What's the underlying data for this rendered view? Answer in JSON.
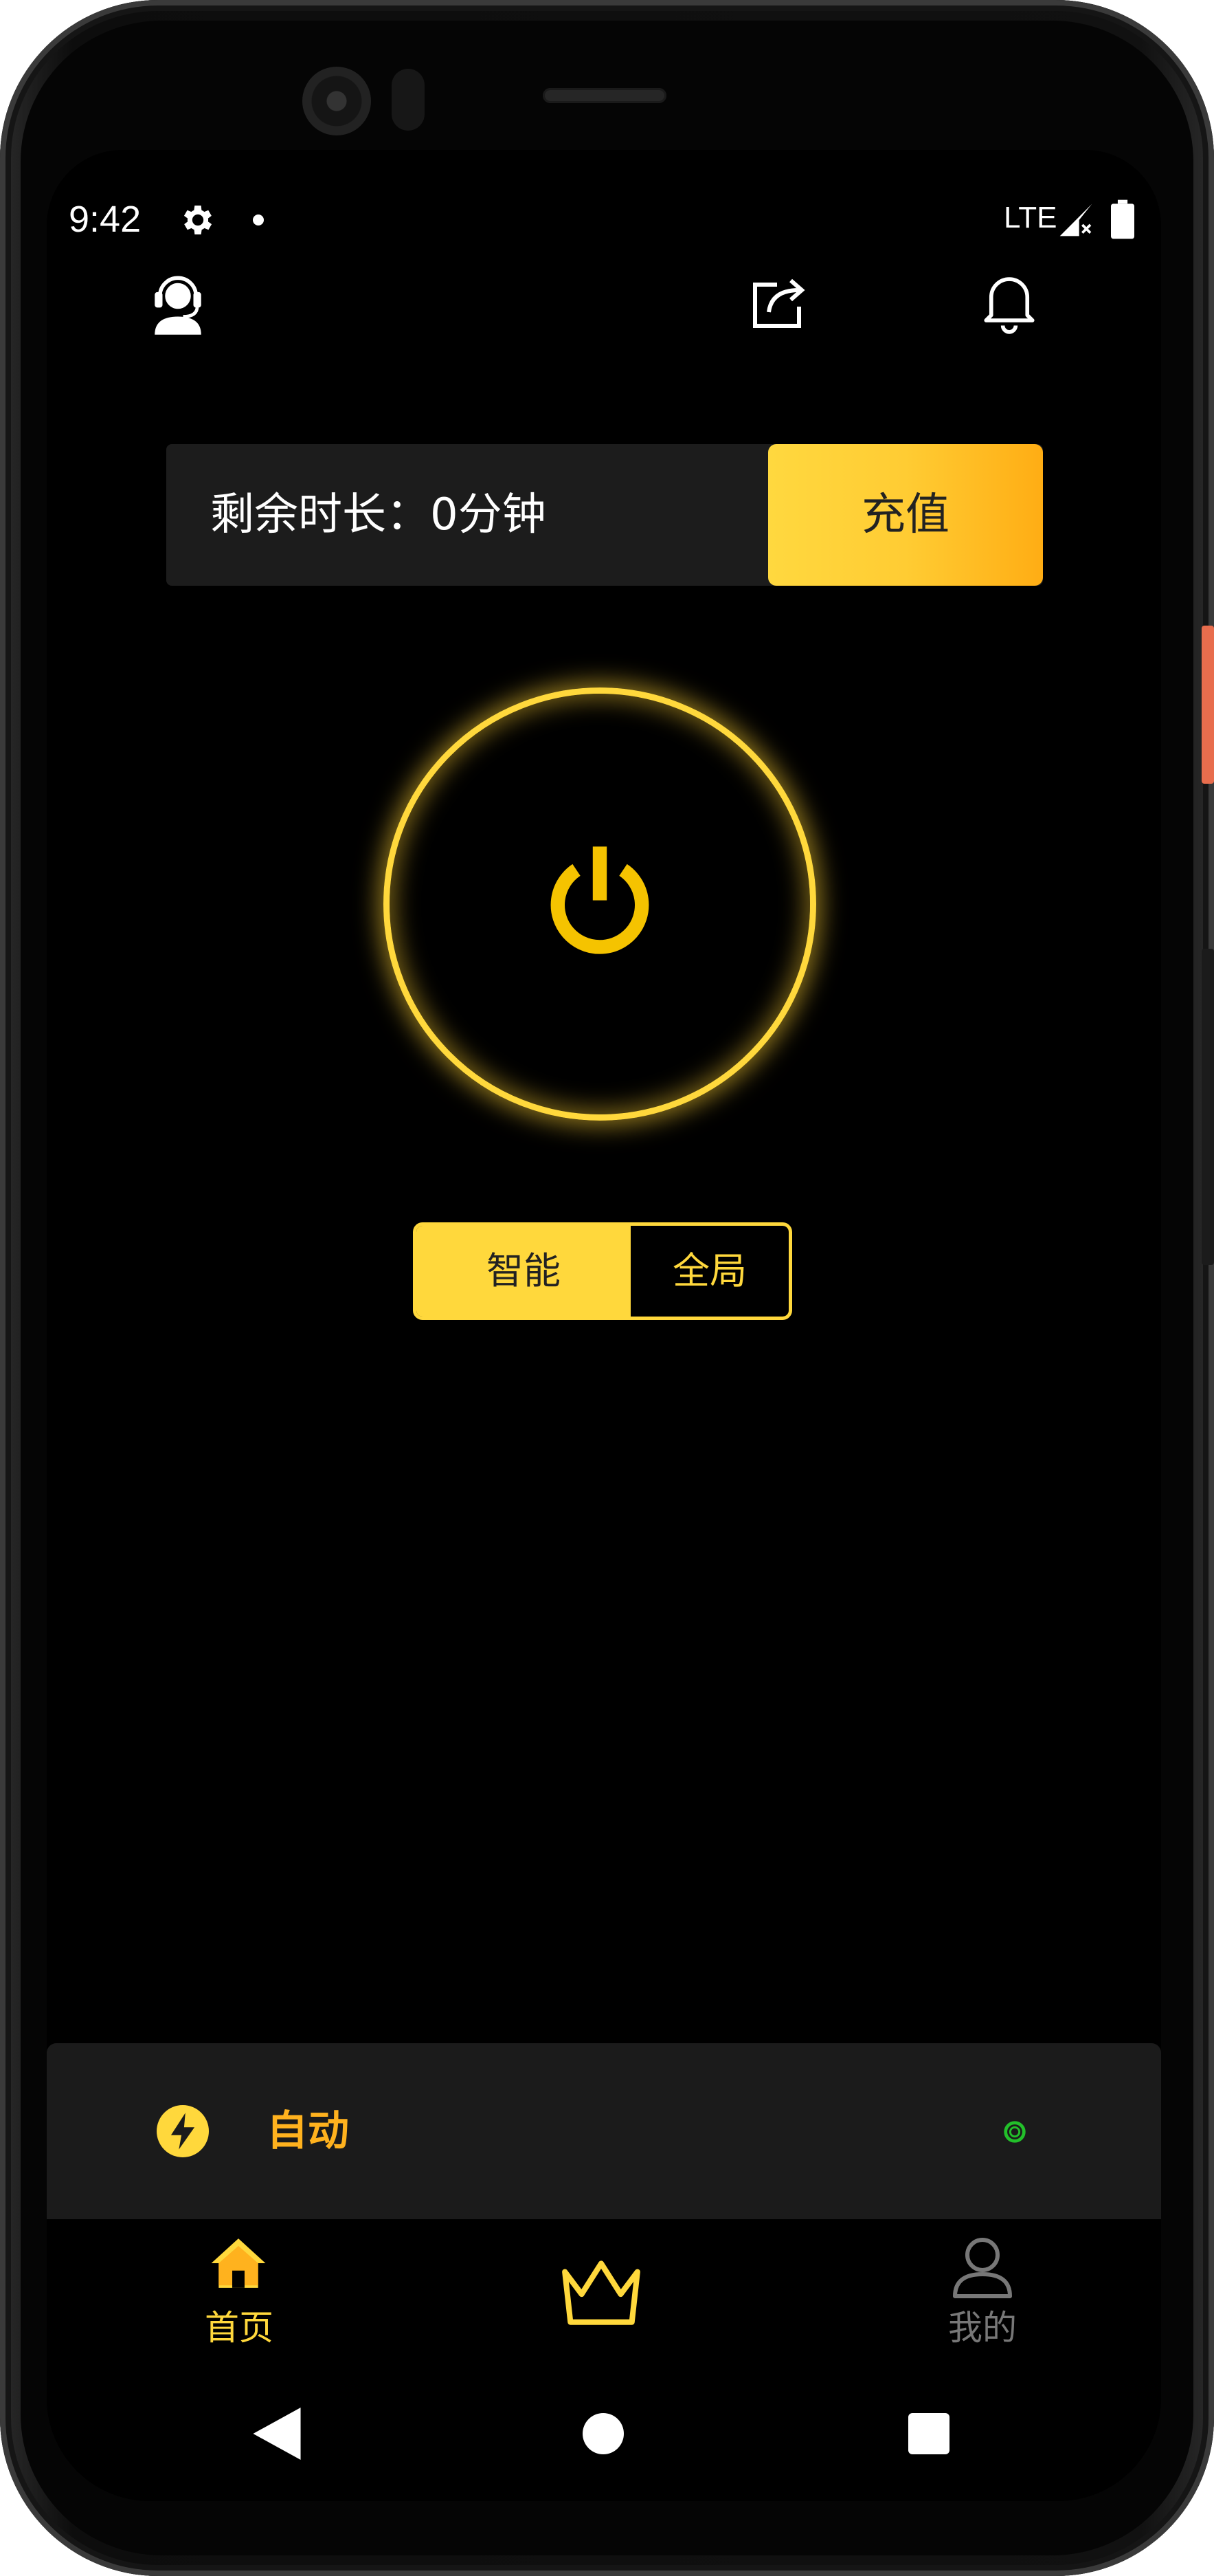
{
  "status_bar": {
    "time": "9:42",
    "network": "LTE",
    "icons": [
      "gear-icon",
      "notification-dot",
      "signal-icon",
      "battery-icon"
    ]
  },
  "header": {
    "icons": [
      "customer-service-icon",
      "share-icon",
      "bell-icon"
    ]
  },
  "time_bar": {
    "label": "剩余时长：0分钟",
    "recharge_label": "充值"
  },
  "power": {
    "icon": "power-icon"
  },
  "mode": {
    "options": [
      "智能",
      "全局"
    ],
    "selected": "智能"
  },
  "auto_bar": {
    "label": "自动",
    "icon": "lightning-icon",
    "status_icon": "status-ring-icon"
  },
  "bottom_nav": {
    "items": [
      {
        "label": "首页",
        "icon": "home-icon",
        "active": true
      },
      {
        "label": "",
        "icon": "crown-icon",
        "active": false
      },
      {
        "label": "我的",
        "icon": "user-icon",
        "active": false
      }
    ]
  },
  "colors": {
    "accent": "#ffd83c",
    "accent_dark": "#ffad14",
    "auto_label": "#ffb21e",
    "background": "#000000",
    "panel": "#1c1c1c"
  }
}
